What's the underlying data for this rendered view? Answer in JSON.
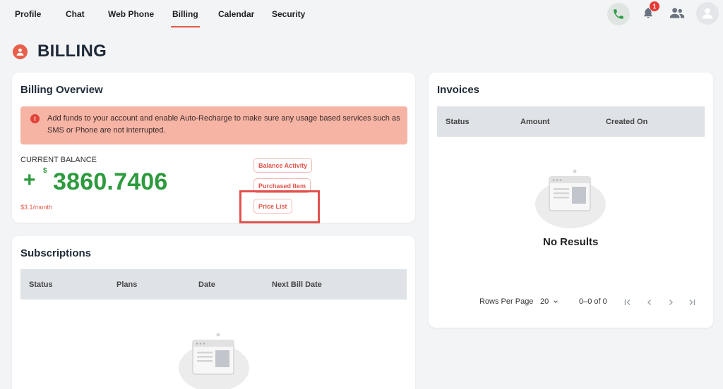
{
  "nav": {
    "tabs": [
      {
        "label": "Profile"
      },
      {
        "label": "Chat"
      },
      {
        "label": "Web Phone"
      },
      {
        "label": "Billing"
      },
      {
        "label": "Calendar"
      },
      {
        "label": "Security"
      }
    ],
    "active_tab": "Billing",
    "notification_count": "1"
  },
  "page": {
    "title": "BILLING"
  },
  "overview": {
    "title": "Billing Overview",
    "alert": "Add funds to your account and enable Auto-Recharge to make sure any usage based services such as SMS or Phone are not interrupted.",
    "balance_label": "CURRENT BALANCE",
    "sign": "+",
    "currency": "$",
    "balance": "3860.7406",
    "monthly": "$3.1/month",
    "buttons": {
      "balance_activity": "Balance Activity",
      "purchased_item": "Purchased Item",
      "price_list": "Price List"
    }
  },
  "subscriptions": {
    "title": "Subscriptions",
    "columns": [
      "Status",
      "Plans",
      "Date",
      "Next Bill Date"
    ]
  },
  "invoices": {
    "title": "Invoices",
    "columns": [
      "Status",
      "Amount",
      "Created On"
    ],
    "empty": "No Results",
    "rows_per_page_label": "Rows Per Page",
    "rows_per_page": "20",
    "range": "0–0 of 0"
  },
  "colors": {
    "accent": "#e0564a",
    "balance_green": "#2d9a3e",
    "alert_bg": "#f6b4a5"
  }
}
